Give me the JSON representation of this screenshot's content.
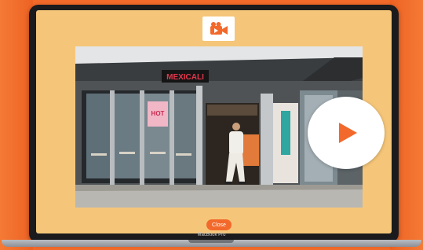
{
  "overlay": {
    "logo_icon": "video-camera-icon",
    "close_label": "Close",
    "play_icon": "play-icon"
  },
  "video": {
    "storefront_sign": "MEXICALI",
    "door_poster": "HOT"
  },
  "device": {
    "model": "MacBook Pro"
  },
  "colors": {
    "background": "#f26a2a",
    "modal": "#f5c679",
    "accent": "#f2692b"
  }
}
